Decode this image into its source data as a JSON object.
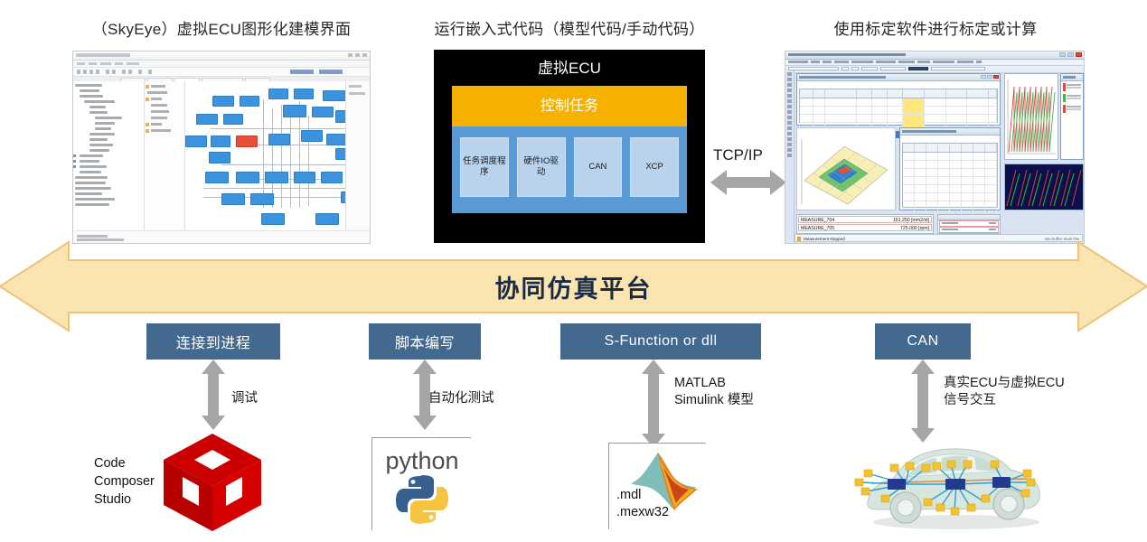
{
  "captions": {
    "left": "（SkyEye）虚拟ECU图形化建模界面",
    "center": "运行嵌入式代码（模型代码/手动代码）",
    "right": "使用标定软件进行标定或计算"
  },
  "ecu_panel": {
    "title": "虚拟ECU",
    "control_task": "控制任务",
    "modules": [
      "任务调度程序",
      "硬件IO驱动",
      "CAN",
      "XCP"
    ],
    "colors": {
      "background": "#000000",
      "control_task": "#f5b000",
      "module_band": "#5b9bd5",
      "module": "#b9d3ee"
    }
  },
  "link": {
    "protocol_label": "TCP/IP",
    "arrow_icon": "double-arrow-horizontal",
    "arrow_color": "#a6a6a6"
  },
  "banner": {
    "title": "协同仿真平台",
    "fill": "#fae5b0",
    "stroke": "#f2c17a",
    "text_color": "#1a2b47",
    "shape": "double-arrow-horizontal"
  },
  "bottom": {
    "columns": [
      {
        "box_label": "连接到进程",
        "arrow_note": "调试",
        "tool_name": "Code\nComposer\nStudio",
        "tool_icon": "code-composer-studio-cube-icon",
        "arrow_icon": "double-arrow-vertical"
      },
      {
        "box_label": "脚本编写",
        "arrow_note": "自动化测试",
        "tool_name": "python",
        "tool_icon": "python-logo-icon",
        "arrow_icon": "double-arrow-vertical"
      },
      {
        "box_label": "S-Function or dll",
        "arrow_note": "MATLAB\nSimulink 模型",
        "tool_name": ".mdl\n.mexw32",
        "tool_icon": "matlab-membrane-icon",
        "arrow_icon": "double-arrow-vertical"
      },
      {
        "box_label": "CAN",
        "arrow_note": "真实ECU与虚拟ECU\n信号交互",
        "tool_name": "",
        "tool_icon": "car-network-icon",
        "arrow_icon": "double-arrow-vertical"
      }
    ],
    "box_color": "#44698e",
    "box_text_color": "#ffffff"
  },
  "right_screenshot": {
    "measure_rows": [
      {
        "name": "MEASURE_704",
        "value": "151.250 [mm2/st]"
      },
      {
        "name": "MEASURE_705",
        "value": "725.000 [rpm]"
      }
    ],
    "status_text": "Measurement stopped",
    "status_link": "Ms buffer level 0%"
  }
}
